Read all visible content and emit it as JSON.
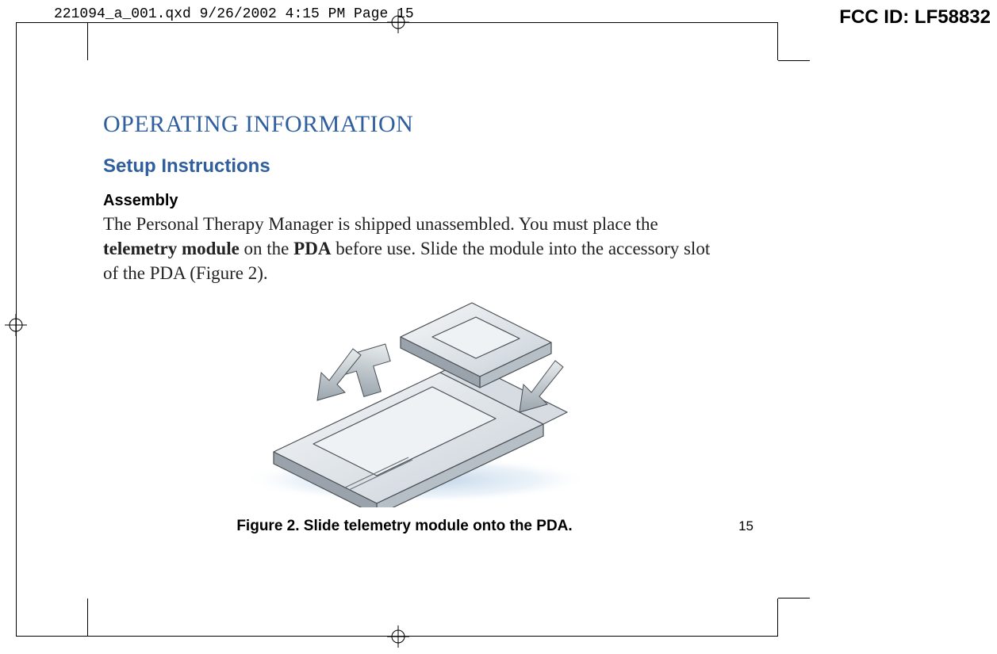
{
  "print_header": "221094_a_001.qxd  9/26/2002  4:15 PM  Page 15",
  "fcc_id": "FCC ID: LF58832",
  "heading_main": "OPERATING INFORMATION",
  "heading_sub": "Setup Instructions",
  "heading_assembly": "Assembly",
  "body": {
    "p1_a": "The Personal Therapy Manager is shipped unassembled. You must place the ",
    "p1_b": "telemetry module",
    "p1_c": " on the ",
    "p1_d": "PDA",
    "p1_e": " before use. Slide the module into the accessory slot of the PDA (Figure 2)."
  },
  "figure_caption": "Figure 2. Slide telemetry module onto the PDA.",
  "page_number": "15",
  "colors": {
    "heading_blue": "#2f5f9f"
  }
}
